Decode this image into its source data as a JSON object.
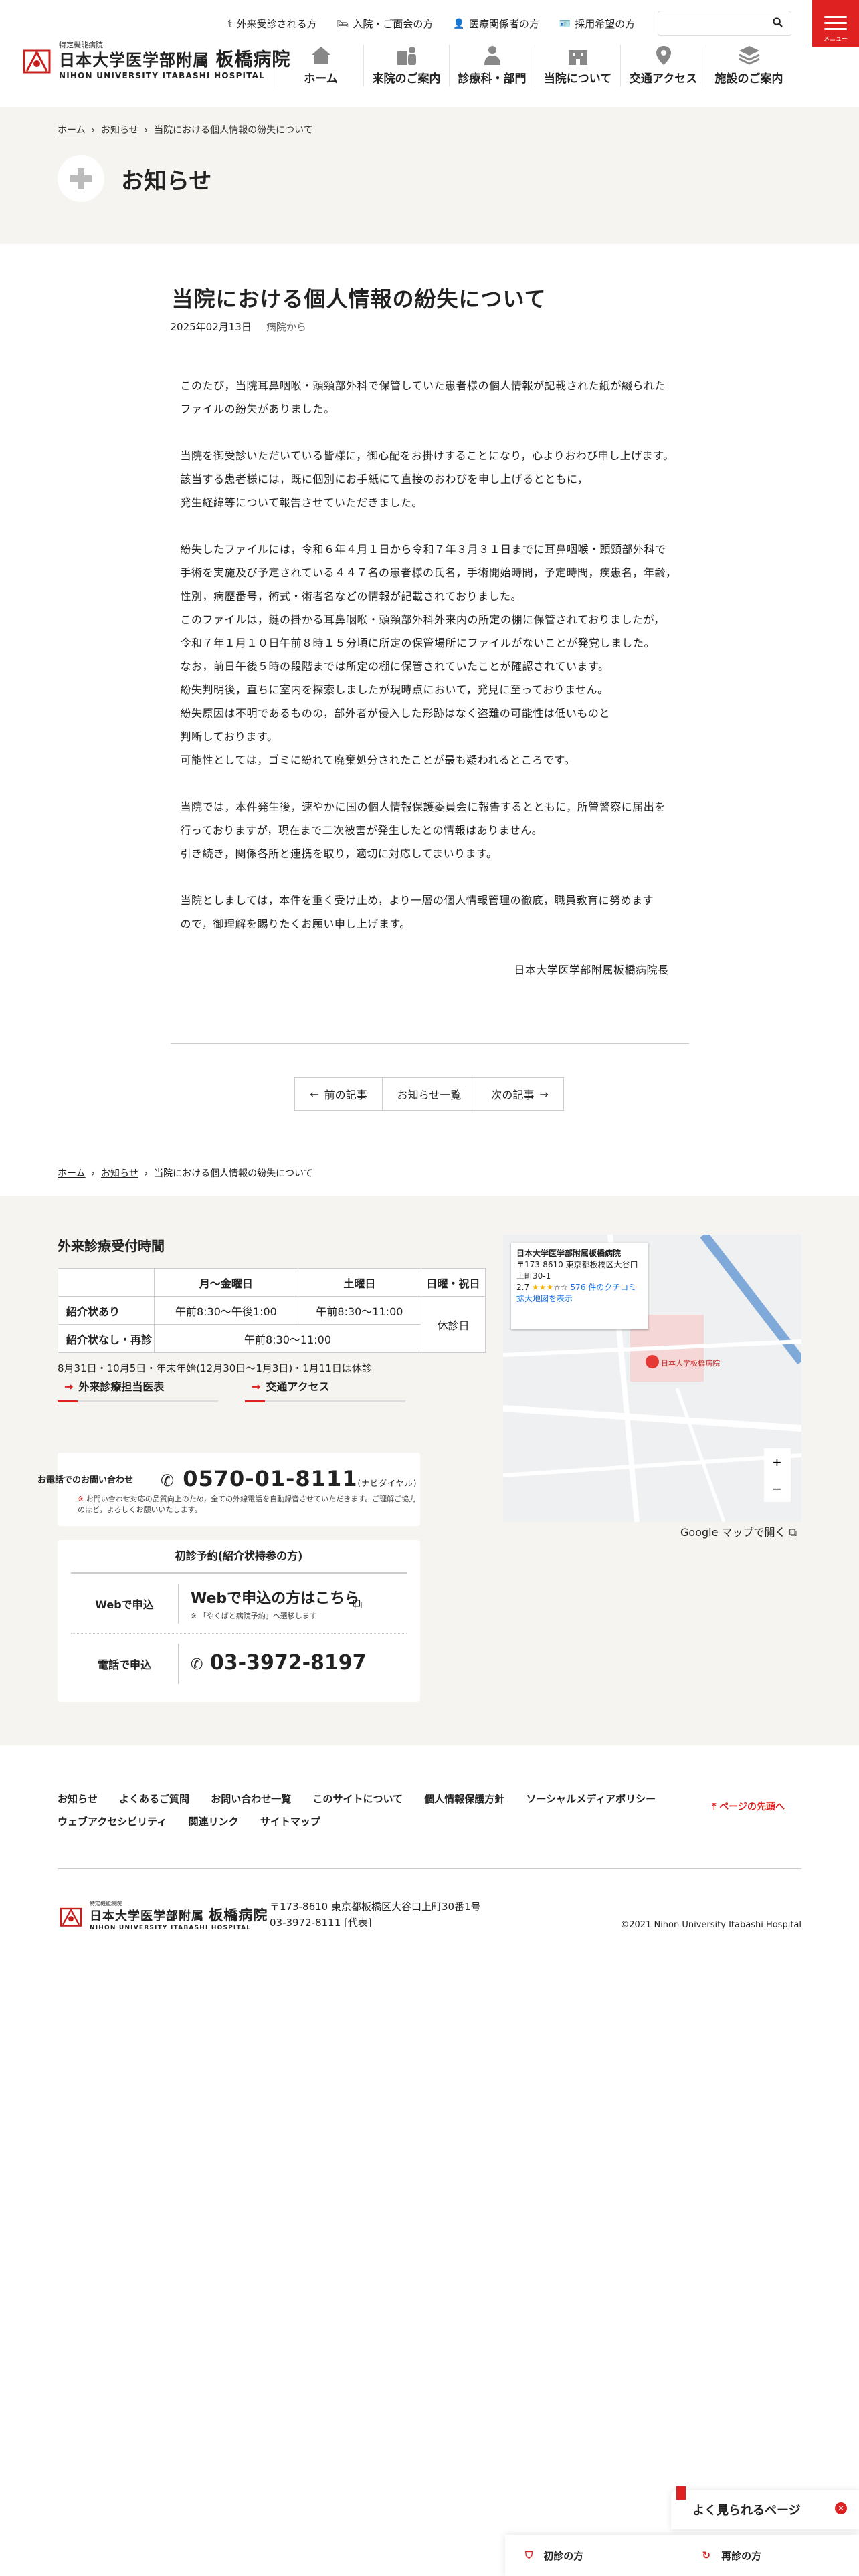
{
  "header": {
    "logo_small": "特定機能病院",
    "logo_main_1": "日本大学医学部附属",
    "logo_main_2": "板橋病院",
    "logo_en": "NIHON UNIVERSITY ITABASHI HOSPITAL",
    "utility": [
      "外来受診される方",
      "入院・ご面会の方",
      "医療関係者の方",
      "採用希望の方"
    ],
    "search_placeholder": "",
    "menu_label": "メニュー",
    "gnav": [
      "ホーム",
      "来院のご案内",
      "診療科・部門",
      "当院について",
      "交通アクセス",
      "施設のご案内"
    ]
  },
  "breadcrumb": {
    "home": "ホーム",
    "section": "お知らせ",
    "current": "当院における個人情報の紛失について"
  },
  "page_title": "お知らせ",
  "article": {
    "title": "当院における個人情報の紛失について",
    "date": "2025年02月13日",
    "category": "病院から",
    "paragraphs": [
      [
        "このたび，当院耳鼻咽喉・頭頸部外科で保管していた患者様の個人情報が記載された紙が綴られた",
        "ファイルの紛失がありました。"
      ],
      [
        "当院を御受診いただいている皆様に，御心配をお掛けすることになり，心よりおわび申し上げます。",
        "該当する患者様には，既に個別にお手紙にて直接のおわびを申し上げるとともに，",
        "発生経緯等について報告させていただきました。"
      ],
      [
        "紛失したファイルには，令和６年４月１日から令和７年３月３１日までに耳鼻咽喉・頭頸部外科で",
        "手術を実施及び予定されている４４７名の患者様の氏名，手術開始時間，予定時間，疾患名，年齢，",
        "性別，病歴番号，術式・術者名などの情報が記載されておりました。",
        "このファイルは，鍵の掛かる耳鼻咽喉・頭頸部外科外来内の所定の棚に保管されておりましたが，",
        "令和７年１月１０日午前８時１５分頃に所定の保管場所にファイルがないことが発覚しました。",
        "なお，前日午後５時の段階までは所定の棚に保管されていたことが確認されています。",
        "紛失判明後，直ちに室内を探索しましたが現時点において，発見に至っておりません。",
        "紛失原因は不明であるものの，部外者が侵入した形跡はなく盗難の可能性は低いものと",
        "判断しております。",
        "可能性としては，ゴミに紛れて廃棄処分されたことが最も疑われるところです。"
      ],
      [
        "当院では，本件発生後，速やかに国の個人情報保護委員会に報告するとともに，所管警察に届出を",
        "行っておりますが，現在まで二次被害が発生したとの情報はありません。",
        "引き続き，関係各所と連携を取り，適切に対応してまいります。"
      ],
      [
        "当院としましては，本件を重く受け止め，より一層の個人情報管理の徹底，職員教育に努めます",
        "ので，御理解を賜りたくお願い申し上げます。"
      ]
    ],
    "signature": "日本大学医学部附属板橋病院長"
  },
  "pager": {
    "prev": "前の記事",
    "list": "お知らせ一覧",
    "next": "次の記事"
  },
  "hours": {
    "title": "外来診療受付時間",
    "cols": [
      "月～金曜日",
      "土曜日",
      "日曜・祝日"
    ],
    "row1_label": "紹介状あり",
    "row1_weekday": "午前8:30～午後1:00",
    "row1_sat": "午前8:30～11:00",
    "holiday": "休診日",
    "row2_label": "紹介状なし・再診",
    "row2_value": "午前8:30～11:00",
    "note": "8月31日・10月5日・年末年始(12月30日～1月3日)・1月11日は休診"
  },
  "links": [
    "外来診療担当医表",
    "交通アクセス"
  ],
  "phone": {
    "label": "お電話でのお問い合わせ",
    "number": "0570-01-8111",
    "suffix": "(ナビダイヤル)",
    "note": "お問い合わせ対応の品質向上のため，全ての外線電話を自動録音させていただきます。ご理解ご協力のほど，よろしくお願いいたします。"
  },
  "booking": {
    "title": "初診予約(紹介状持参の方)",
    "web_label": "Webで申込",
    "web_link": "Webで申込の方はこちら",
    "web_sub": "「やくばと病院予約」へ遷移します",
    "tel_label": "電話で申込",
    "tel_number": "03-3972-8197"
  },
  "map": {
    "name": "日本大学医学部附属板橋病院",
    "address": "〒173-8610 東京都板橋区大谷口上町30-1",
    "rating": "2.7",
    "reviews": "576 件のクチコミ",
    "enlarge": "拡大地図を表示",
    "pin_label": "日本大学板橋病院",
    "open_link": "Google マップで開く"
  },
  "footer": {
    "nav": [
      "お知らせ",
      "よくあるご質問",
      "お問い合わせ一覧",
      "このサイトについて",
      "個人情報保護方針",
      "ソーシャルメディアポリシー",
      "ウェブアクセシビリティ",
      "関連リンク",
      "サイトマップ"
    ],
    "totop": "ページの先頭へ",
    "address": "〒173-8610 東京都板橋区大谷口上町30番1号",
    "tel": "03-3972-8111 [代表]",
    "copyright": "©2021 Nihon University Itabashi Hospital"
  },
  "floating": {
    "faq": "よく見られるページ",
    "first_visit": "初診の方",
    "revisit": "再診の方"
  },
  "colors": {
    "accent": "#df2121",
    "beige": "#f6f4f0"
  }
}
